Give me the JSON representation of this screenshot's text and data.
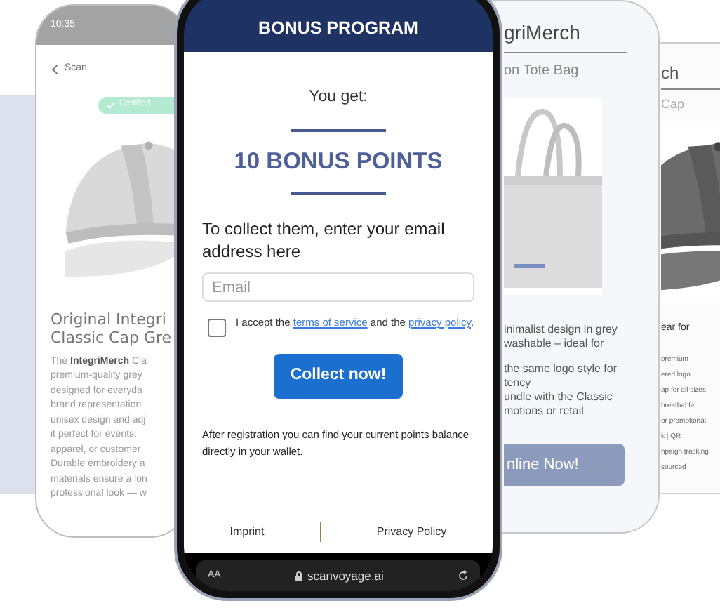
{
  "back_phone_right": {
    "title": "ch",
    "subtitle": "Cap",
    "lines": [
      {
        "text": "ear for",
        "kind": "heading"
      },
      {
        "text": "premium",
        "kind": "small"
      },
      {
        "text": "ered logo",
        "kind": "small"
      },
      {
        "text": "ap for all sizes",
        "kind": "small"
      },
      {
        "text": "breathable",
        "kind": "small"
      },
      {
        "text": "or promotional",
        "kind": "small"
      },
      {
        "text": "k | QR",
        "kind": "small"
      },
      {
        "text": "npaign tracking",
        "kind": "small"
      },
      {
        "text": "sourced",
        "kind": "small"
      }
    ]
  },
  "back_phone_middle": {
    "title": "griMerch",
    "subtitle": "on Tote Bag",
    "lines": [
      "inimalist design in grey",
      "washable  – ideal for",
      "the same logo style for",
      "tency",
      "undle with the Classic",
      "motions or retail"
    ],
    "button": "nline Now!"
  },
  "back_phone_left": {
    "status_time": "10:35",
    "back_link": "Scan",
    "badge": "Certified",
    "title_lines": [
      "Original Integri",
      "Classic Cap Gre"
    ],
    "description": [
      "The **IntegriMerch** Cla",
      "premium-quality grey",
      "designed for everyda",
      "brand representation",
      "unisex design and adj",
      "it perfect for events,",
      "apparel, or customer",
      "Durable embroidery a",
      "materials ensure a lon",
      "professional look — w"
    ]
  },
  "main_phone": {
    "header": "BONUS PROGRAM",
    "intro": "You get:",
    "reward": "10 BONUS POINTS",
    "prompt": "To collect them, enter your email address here",
    "email": {
      "placeholder": "Email"
    },
    "consent": {
      "checked": false,
      "before": "I accept the",
      "terms_link": "terms of service",
      "middle": "and the",
      "privacy_link": "privacy policy",
      "after": "."
    },
    "button": "Collect now!",
    "note": "After registration you can find your current points balance directly in your wallet.",
    "footer_links": [
      "Imprint",
      "Privacy Policy"
    ],
    "browser": {
      "text_size": "AA",
      "url": "scanvoyage.ai"
    }
  }
}
